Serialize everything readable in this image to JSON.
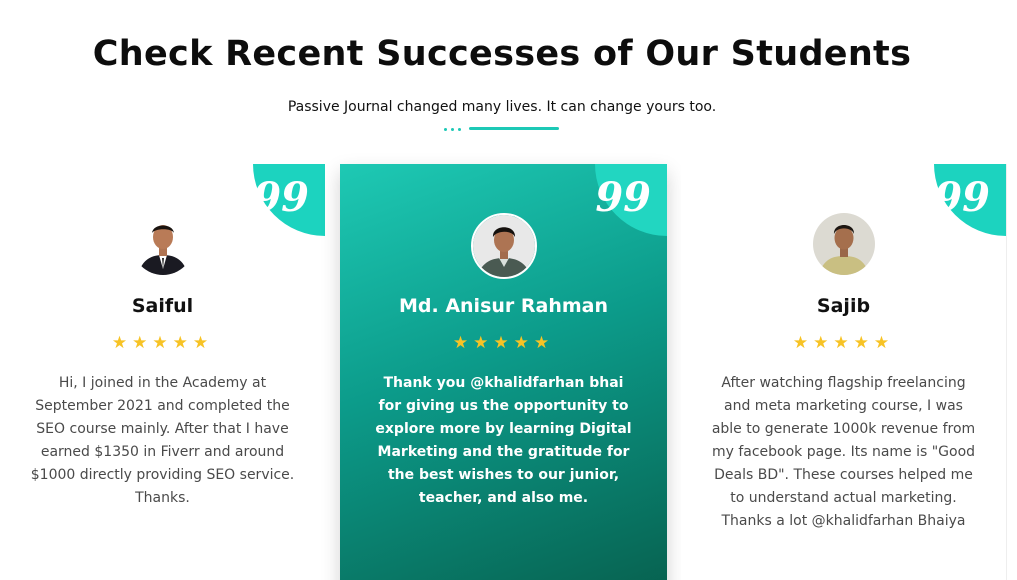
{
  "section": {
    "title": "Check Recent Successes of Our Students",
    "subtitle": "Passive Journal changed many lives. It can change yours too."
  },
  "colors": {
    "accent": "#1cc9b6",
    "star": "#f7c325",
    "highlight_card_start": "#1ec9b4",
    "highlight_card_end": "#07614f"
  },
  "testimonials": [
    {
      "name": "Saiful",
      "rating": 5,
      "quote_icon": "quote-icon",
      "text": "Hi, I joined in the Academy at September 2021 and completed the SEO course mainly. After that I have earned $1350 in Fiverr and around $1000 directly providing SEO service. Thanks."
    },
    {
      "name": "Md. Anisur Rahman",
      "rating": 5,
      "quote_icon": "quote-icon",
      "text": "Thank you @khalidfarhan bhai for giving us the opportunity to explore more by learning Digital Marketing and the gratitude for the best wishes to our junior, teacher, and also me."
    },
    {
      "name": "Sajib",
      "rating": 5,
      "quote_icon": "quote-icon",
      "text": "After watching flagship freelancing and meta marketing course, I was able to generate 1000k revenue from my facebook page. Its name is \"Good Deals BD\". These courses helped me to understand actual marketing. Thanks a lot @khalidfarhan Bhaiya"
    }
  ]
}
